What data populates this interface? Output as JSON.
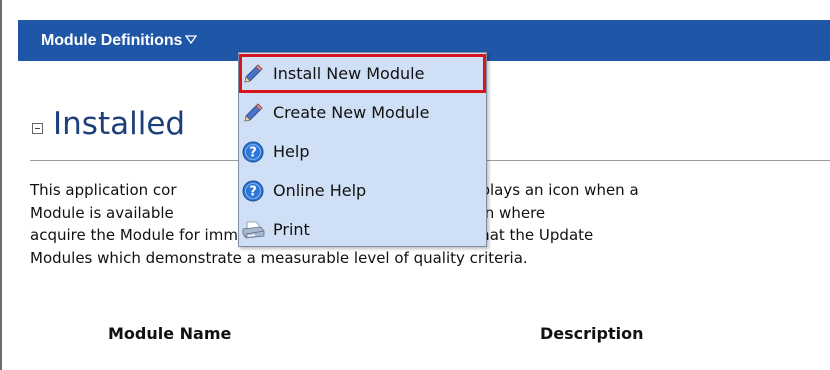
{
  "header": {
    "title": "Module Definitions",
    "dropdown_icon": "triangle-down-icon",
    "background": "#1f56a8"
  },
  "menu": {
    "items": [
      {
        "label": "Install New Module",
        "icon": "pencil-icon",
        "active": true
      },
      {
        "label": "Create New Module",
        "icon": "pencil-icon",
        "active": false
      },
      {
        "label": "Help",
        "icon": "help-icon",
        "active": false
      },
      {
        "label": "Online Help",
        "icon": "help-icon",
        "active": false
      },
      {
        "label": "Print",
        "icon": "printer-icon",
        "active": false
      }
    ],
    "highlight_color": "#d8141c"
  },
  "section": {
    "collapse_icon": "collapse-minus-icon",
    "title": "Installed"
  },
  "description": {
    "lines": [
      "This application cor",
      "e which displays an icon when a",
      "Module is available",
      "edirect you to a location where",
      "acquire the Module for immediate installation. Please note that the Update",
      "Modules which demonstrate a measurable level of quality criteria."
    ]
  },
  "table": {
    "headers": [
      "Module Name",
      "Description"
    ]
  }
}
